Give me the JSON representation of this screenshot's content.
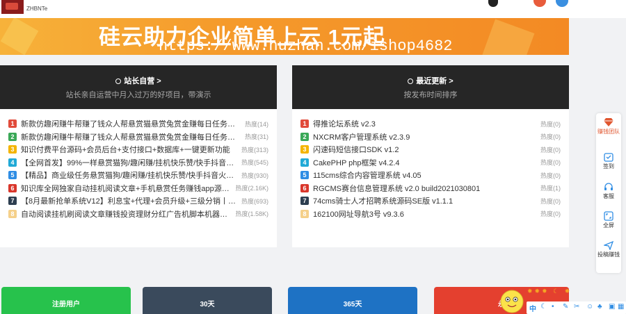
{
  "header": {
    "logo_text": "ZHBNTe"
  },
  "banner": {
    "title": "硅云助力企业简单上云 1元起",
    "url": "https://www.huzhan.com/ishop4682"
  },
  "cards": [
    {
      "title": "站长自营 >",
      "subtitle": "站长亲自运营中月入过万的好项目，带演示",
      "items": [
        {
          "rank": "1",
          "title": "新款仿趣闲赚牛帮赚了钱众人帮悬赏猫悬赏兔赏金赚每日任务平台a...",
          "heat": "热度(14)"
        },
        {
          "rank": "2",
          "title": "新款仿趣闲赚牛帮赚了钱众人帮悬赏猫悬赏兔赏金赚每日任务平台a...",
          "heat": "热度(31)"
        },
        {
          "rank": "3",
          "title": "知识付费平台源码+会员后台+支付接口+数据库+一键更新功能",
          "heat": "热度(313)"
        },
        {
          "rank": "4",
          "title": "【全网首发】99%一样悬赏猫狗/趣闲赚/挂机快乐赞/快手抖音火山...",
          "heat": "热度(545)"
        },
        {
          "rank": "5",
          "title": "【精品】商业级任务悬赏猫狗/趣闲赚/挂机快乐赞/快手抖音火山点...",
          "heat": "热度(930)"
        },
        {
          "rank": "6",
          "title": "知识库全网独家自动挂机阅读文章+手机悬赏任务赚钱app源码（可...",
          "heat": "热度(2.16K)"
        },
        {
          "rank": "7",
          "title": "【8月最新抢单系统V12】利息宝+代理+会员升级+三级分销丨抢单...",
          "heat": "热度(693)"
        },
        {
          "rank": "8",
          "title": "自动阅读挂机刷阅读文章赚钱投资理财分红广告机脚本机器人可封装...",
          "heat": "热度(1.58K)"
        }
      ]
    },
    {
      "title": "最近更新 >",
      "subtitle": "按发布时间排序",
      "items": [
        {
          "rank": "1",
          "title": "得推论坛系统 v2.3",
          "heat": "热度(0)"
        },
        {
          "rank": "2",
          "title": "NXCRM客户管理系统 v2.3.9",
          "heat": "热度(0)"
        },
        {
          "rank": "3",
          "title": "闪速码短信接口SDK v1.2",
          "heat": "热度(0)"
        },
        {
          "rank": "4",
          "title": "CakePHP php框架 v4.2.4",
          "heat": "热度(0)"
        },
        {
          "rank": "5",
          "title": "115cms综合内容管理系统 v4.05",
          "heat": "热度(0)"
        },
        {
          "rank": "6",
          "title": "RGCMS赛台信息管理系统 v2.0 build2021030801",
          "heat": "热度(1)"
        },
        {
          "rank": "7",
          "title": "74cms骑士人才招聘系统源码SE版 v1.1.1",
          "heat": "热度(0)"
        },
        {
          "rank": "8",
          "title": "162100网址导航3号 v9.3.6",
          "heat": "热度(0)"
        }
      ]
    }
  ],
  "side_tools": [
    {
      "label": "赚钱团队",
      "icon": "diamond-icon"
    },
    {
      "label": "签到",
      "icon": "checkin-icon"
    },
    {
      "label": "客服",
      "icon": "headset-icon"
    },
    {
      "label": "全屏",
      "icon": "fullscreen-icon"
    },
    {
      "label": "投稿赚钱",
      "icon": "send-icon"
    }
  ],
  "tiles": [
    {
      "label": "注册用户",
      "color": "#27c24c"
    },
    {
      "label": "30天",
      "color": "#3a4a5c"
    },
    {
      "label": "365天",
      "color": "#1e72c4"
    },
    {
      "label": "永",
      "color": "#e4402f"
    }
  ],
  "ime": {
    "lang": "中"
  }
}
